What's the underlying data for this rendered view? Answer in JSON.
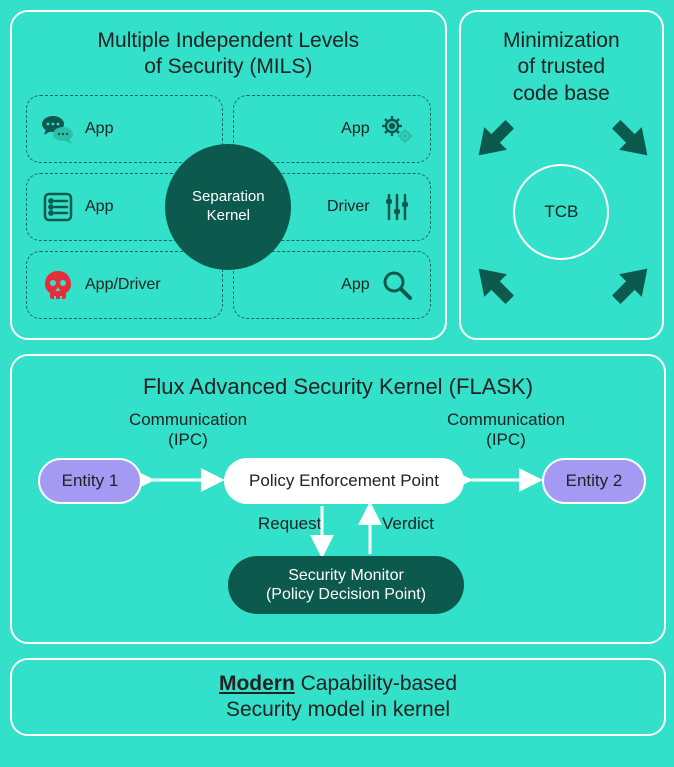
{
  "mils": {
    "title_line1": "Multiple Independent Levels",
    "title_line2": "of Security (MILS)",
    "cells": [
      {
        "label": "App",
        "icon": "chat"
      },
      {
        "label": "App",
        "icon": "gears"
      },
      {
        "label": "App",
        "icon": "list"
      },
      {
        "label": "Driver",
        "icon": "sliders"
      },
      {
        "label": "App/Driver",
        "icon": "skull"
      },
      {
        "label": "App",
        "icon": "magnifier"
      }
    ],
    "kernel_line1": "Separation",
    "kernel_line2": "Kernel"
  },
  "tcb": {
    "title_line1": "Minimization",
    "title_line2": "of trusted",
    "title_line3": "code base",
    "label": "TCB"
  },
  "flask": {
    "title": "Flux Advanced Security Kernel (FLASK)",
    "comm_left_line1": "Communication",
    "comm_left_line2": "(IPC)",
    "comm_right_line1": "Communication",
    "comm_right_line2": "(IPC)",
    "entity1": "Entity 1",
    "entity2": "Entity 2",
    "pep": "Policy Enforcement Point",
    "request": "Request",
    "verdict": "Verdict",
    "monitor_line1": "Security Monitor",
    "monitor_line2": "(Policy Decision Point)"
  },
  "bottom": {
    "modern": "Modern",
    "rest1": " Capability-based",
    "line2": "Security model in kernel"
  }
}
